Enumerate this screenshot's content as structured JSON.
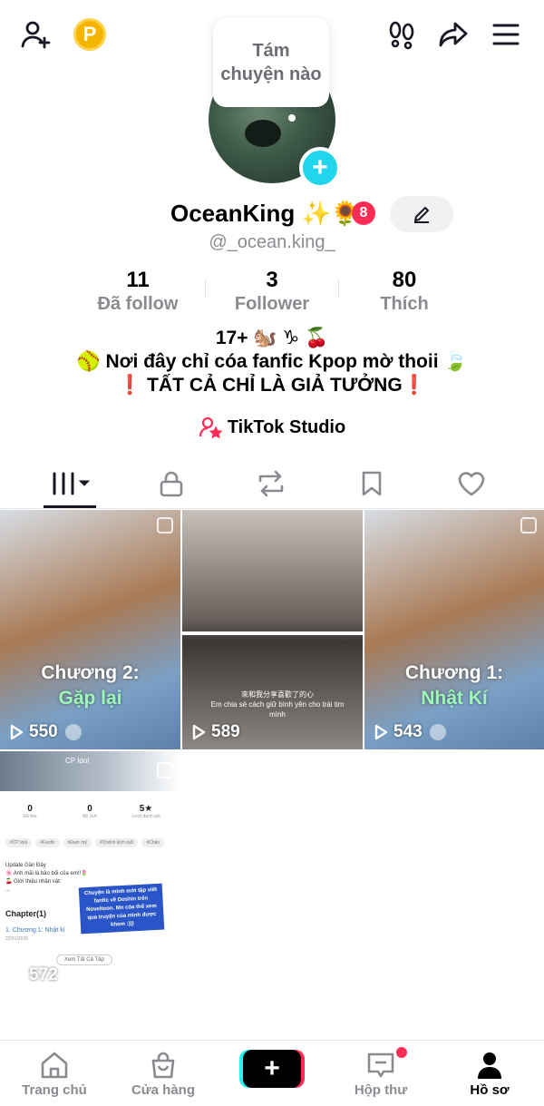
{
  "header": {
    "add_friend_icon": "person-plus-icon",
    "coin_label": "P",
    "footprints_icon": "footprints-icon",
    "share_icon": "share-icon",
    "menu_icon": "menu-icon"
  },
  "profile": {
    "note_bubble": "Tám chuyện nào",
    "display_name": "OceanKing ✨🌻",
    "notification_count": "8",
    "username": "@_ocean.king_",
    "stats": [
      {
        "value": "11",
        "label": "Đã follow"
      },
      {
        "value": "3",
        "label": "Follower"
      },
      {
        "value": "80",
        "label": "Thích"
      }
    ],
    "bio": [
      "17+ 🐿️ ♑ 🍒",
      "🥎 Nơi đây chỉ cóa fanfic Kpop mờ thoii 🍃",
      "❗ TẤT CẢ CHỈ LÀ GIẢ TƯỞNG❗"
    ],
    "studio_label": "TikTok Studio"
  },
  "tabs": [
    {
      "name": "videos",
      "icon": "grid-icon"
    },
    {
      "name": "private",
      "icon": "lock-icon"
    },
    {
      "name": "reposts",
      "icon": "repost-icon"
    },
    {
      "name": "saved",
      "icon": "bookmark-icon"
    },
    {
      "name": "liked",
      "icon": "heart-icon"
    }
  ],
  "videos": [
    {
      "title_line1": "Chương 2:",
      "title_line2": "Gặp lại",
      "views": "550"
    },
    {
      "views": "589",
      "subtitle_cn": "來和我分享喜歡了的心",
      "subtitle_vi": "Em chia sẻ cách giữ bình yên cho trái tim mình"
    },
    {
      "title_line1": "Chương 1:",
      "title_line2": "Nhật Kí",
      "views": "543"
    },
    {
      "views": "572",
      "mini_label": "CP Idol",
      "mini_stats": [
        {
          "value": "0",
          "label": "Đã like"
        },
        {
          "value": "0",
          "label": "Bộ Sưt"
        },
        {
          "value": "5★",
          "label": "Lượt đánh giá"
        }
      ],
      "mini_tags": [
        "#CP Idol",
        "#Fanfic",
        "#Đam mỹ",
        "#Chênh lệch tuổi",
        "#Chấn"
      ],
      "mini_lines": [
        "Update Gần Đây",
        "🌸 Anh mãi là bảo bối của em!!🌷",
        "🍒 Giới thiệu nhân vật:",
        "..."
      ],
      "mini_chapter": "Chapter(1)",
      "mini_chapter1": "1. Chương 1: Nhật kí",
      "mini_date": "22/01/2026",
      "mini_more": "Xem Tất Cả Tập",
      "mini_note": "Chuyện là mình mới tập viết fanfic về Doshin trên Noveltoon. Mn cóa thể xem qua truyện của mình được khom :)))"
    }
  ],
  "bottom_nav": [
    {
      "label": "Trang chủ",
      "icon": "home-icon"
    },
    {
      "label": "Cửa hàng",
      "icon": "shop-icon"
    },
    {
      "label": "",
      "icon": "plus-icon"
    },
    {
      "label": "Hộp thư",
      "icon": "inbox-icon"
    },
    {
      "label": "Hồ sơ",
      "icon": "profile-icon"
    }
  ],
  "colors": {
    "accent_pink": "#fe2c55",
    "accent_cyan": "#25f4ee",
    "plus_badge": "#20d5ec",
    "coin": "#f5b400"
  }
}
